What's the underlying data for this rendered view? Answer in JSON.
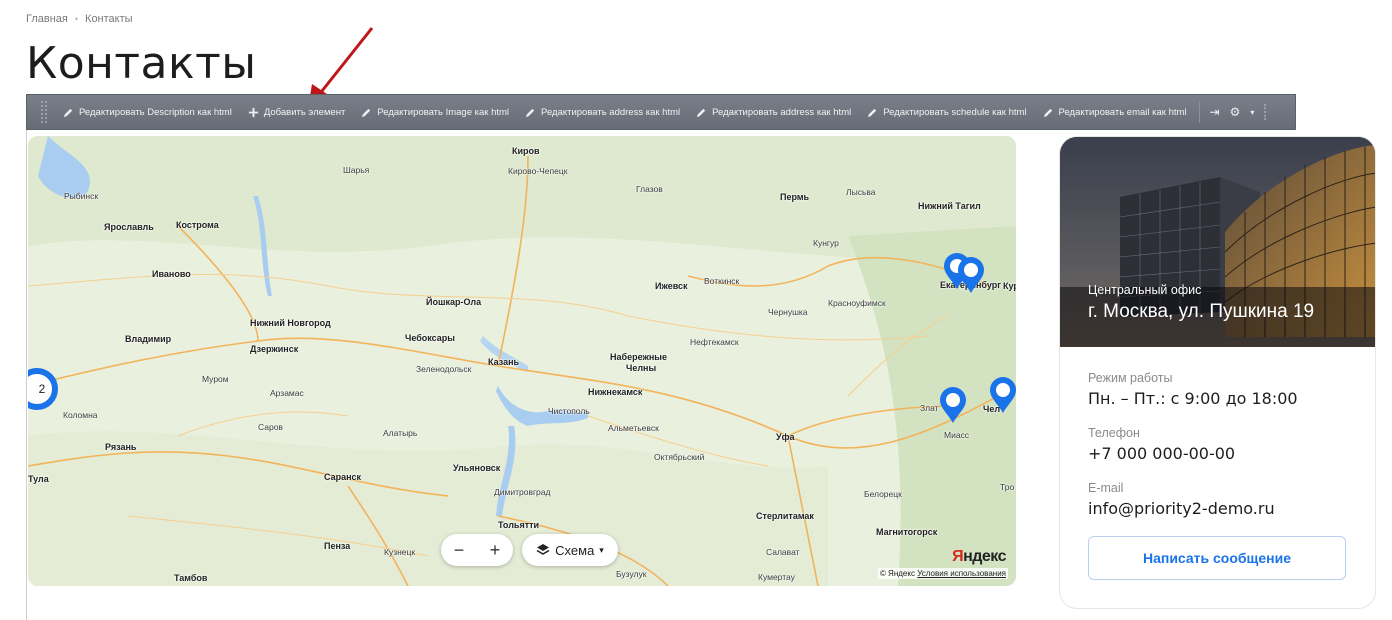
{
  "breadcrumb": {
    "home": "Главная",
    "current": "Контакты"
  },
  "page": {
    "title": "Контакты"
  },
  "toolbar": {
    "items": [
      "Редактировать Description как html",
      "Добавить элемент",
      "Редактировать Image как html",
      "Редактировать address как html",
      "Редактировать address как html",
      "Редактировать schedule как html",
      "Редактировать email как html"
    ]
  },
  "map": {
    "cluster_count": "2",
    "zoom_minus": "−",
    "zoom_plus": "+",
    "layer_label": "Схема",
    "logo_y": "Я",
    "logo_rest": "ндекс",
    "copyright": "© Яндекс",
    "terms": "Условия использования",
    "cities": [
      {
        "name": "Киров",
        "bold": true
      },
      {
        "name": "Кирово-Чепецк"
      },
      {
        "name": "Рыбинск"
      },
      {
        "name": "Шарья"
      },
      {
        "name": "Глазов"
      },
      {
        "name": "Пермь",
        "bold": true
      },
      {
        "name": "Лысьва"
      },
      {
        "name": "Нижний Тагил",
        "bold": true
      },
      {
        "name": "Ярославль",
        "bold": true
      },
      {
        "name": "Кострома",
        "bold": true
      },
      {
        "name": "Кунгур"
      },
      {
        "name": "Иваново",
        "bold": true
      },
      {
        "name": "Ижевск",
        "bold": true
      },
      {
        "name": "Воткинск"
      },
      {
        "name": "Екатеринбург",
        "bold": true
      },
      {
        "name": "Йошкар-Ола",
        "bold": true
      },
      {
        "name": "Красноуфимск"
      },
      {
        "name": "Нижний Новгород",
        "bold": true
      },
      {
        "name": "Чернушка"
      },
      {
        "name": "Владимир",
        "bold": true
      },
      {
        "name": "Чебоксары",
        "bold": true
      },
      {
        "name": "Нефтекамск"
      },
      {
        "name": "Дзержинск",
        "bold": true
      },
      {
        "name": "Набережные"
      },
      {
        "name": "Челны"
      },
      {
        "name": "Казань",
        "bold": true
      },
      {
        "name": "Зеленодольск"
      },
      {
        "name": "Муром"
      },
      {
        "name": "Нижнекамск",
        "bold": true
      },
      {
        "name": "Арзамас"
      },
      {
        "name": "Коломна"
      },
      {
        "name": "Чистополь"
      },
      {
        "name": "Альметьевск"
      },
      {
        "name": "Саров"
      },
      {
        "name": "Алатырь"
      },
      {
        "name": "Уфа",
        "bold": true
      },
      {
        "name": "Рязань",
        "bold": true
      },
      {
        "name": "Октябрьский"
      },
      {
        "name": "Миасс"
      },
      {
        "name": "Ульяновск",
        "bold": true
      },
      {
        "name": "Саранск",
        "bold": true
      },
      {
        "name": "Белорецк"
      },
      {
        "name": "Тула",
        "bold": true
      },
      {
        "name": "Димитровград"
      },
      {
        "name": "Стерлитамак",
        "bold": true
      },
      {
        "name": "Тольятти",
        "bold": true
      },
      {
        "name": "Магнитогорск",
        "bold": true
      },
      {
        "name": "Пенза",
        "bold": true
      },
      {
        "name": "Кузнецк"
      },
      {
        "name": "Салават"
      },
      {
        "name": "Тамбов",
        "bold": true
      },
      {
        "name": "Бузулук"
      },
      {
        "name": "Кумертау"
      },
      {
        "name": "Злат"
      },
      {
        "name": "Чел"
      },
      {
        "name": "Кург"
      },
      {
        "name": "Тро"
      }
    ]
  },
  "card": {
    "label": "Центральный офис",
    "address": "г. Москва, ул. Пушкина 19",
    "schedule_label": "Режим работы",
    "schedule_value": "Пн. – Пт.: с 9:00 до 18:00",
    "phone_label": "Телефон",
    "phone_value": "+7 000 000-00-00",
    "email_label": "E-mail",
    "email_value": "info@priority2-demo.ru",
    "button_label": "Написать сообщение"
  },
  "colors": {
    "accent": "#1a73e8",
    "toolbar": "#6b7280",
    "arrow": "#c0161b"
  }
}
